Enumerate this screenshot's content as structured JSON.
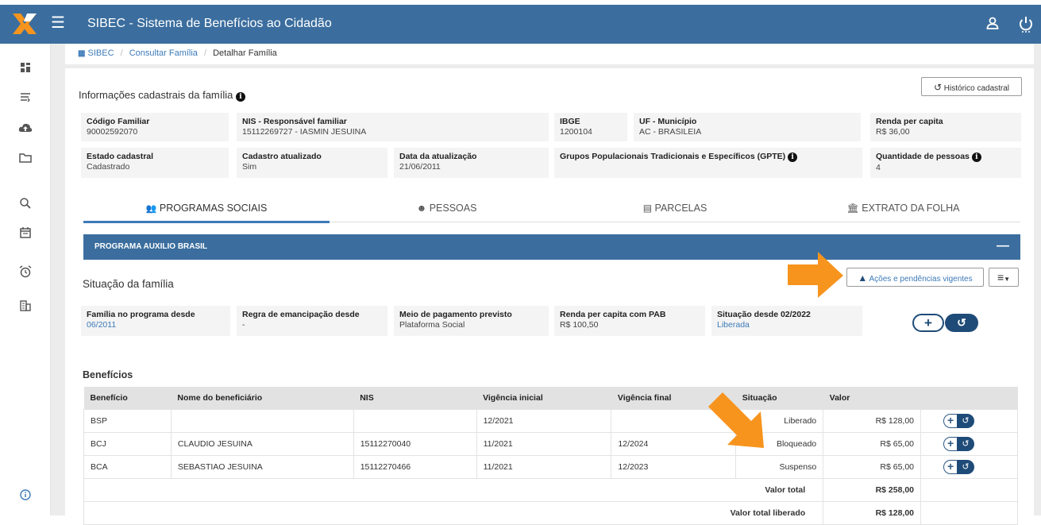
{
  "app": {
    "title": "SIBEC - Sistema de Benefícios ao Cidadão"
  },
  "topbar_icons": [
    "menu-icon",
    "user-icon",
    "power-icon"
  ],
  "sidebar_icons": [
    "dashboard-icon",
    "list-icon",
    "cloud-upload-icon",
    "folder-icon",
    "search-icon",
    "calendar-icon",
    "alarm-clock-icon",
    "building-icon",
    "info-icon"
  ],
  "breadcrumb": {
    "root": "SIBEC",
    "sep": "/",
    "level1": "Consultar Família",
    "current": "Detalhar Família"
  },
  "family_info": {
    "title": "Informações cadastrais da família",
    "history_button": "Histórico cadastral",
    "fields": {
      "codigo_familiar": {
        "label": "Código Familiar",
        "value": "90002592070"
      },
      "nis": {
        "label": "NIS - Responsável familiar",
        "value": "15112269727 - IASMIN JESUINA"
      },
      "ibge": {
        "label": "IBGE",
        "value": "1200104"
      },
      "uf_municipio": {
        "label": "UF - Município",
        "value": "AC - BRASILEIA"
      },
      "renda_per_capita": {
        "label": "Renda per capita",
        "value": "R$ 36,00"
      },
      "estado_cadastral": {
        "label": "Estado cadastral",
        "value": "Cadastrado"
      },
      "cadastro_atualizado": {
        "label": "Cadastro atualizado",
        "value": "Sim"
      },
      "data_atualizacao": {
        "label": "Data da atualização",
        "value": "21/06/2011"
      },
      "gpte": {
        "label": "Grupos Populacionais Tradicionais e Específicos (GPTE)",
        "value": ""
      },
      "quantidade_pessoas": {
        "label": "Quantidade de pessoas",
        "value": "4"
      }
    }
  },
  "tabs": [
    {
      "label": "PROGRAMAS SOCIAIS",
      "icon": "users-icon",
      "active": true
    },
    {
      "label": "PESSOAS",
      "icon": "user-circle-icon",
      "active": false
    },
    {
      "label": "PARCELAS",
      "icon": "list-alt-icon",
      "active": false
    },
    {
      "label": "EXTRATO DA FOLHA",
      "icon": "bank-icon",
      "active": false
    }
  ],
  "program": {
    "name": "PROGRAMA AUXILIO BRASIL",
    "collapse_symbol": "—"
  },
  "situacao": {
    "title": "Situação da família",
    "acoes_button": "Ações e pendências vigentes",
    "fields": {
      "familia_programa": {
        "label": "Família no programa desde",
        "value": "06/2011"
      },
      "regra_emancipacao": {
        "label": "Regra de emancipação desde",
        "value": "-"
      },
      "meio_pagamento": {
        "label": "Meio de pagamento previsto",
        "value": "Plataforma Social"
      },
      "renda_pab": {
        "label": "Renda per capita com PAB",
        "value": "R$ 100,50"
      },
      "situacao_desde": {
        "label": "Situação desde 02/2022",
        "value": "Liberada"
      }
    }
  },
  "beneficios": {
    "title": "Benefícios",
    "columns": [
      "Benefício",
      "Nome do beneficiário",
      "NIS",
      "Vigência inicial",
      "Vigência final",
      "Situação",
      "Valor"
    ],
    "rows": [
      {
        "beneficio": "BSP",
        "nome": "",
        "nis": "",
        "vig_ini": "12/2021",
        "vig_fim": "",
        "situacao": "Liberado",
        "valor": "R$ 128,00"
      },
      {
        "beneficio": "BCJ",
        "nome": "CLAUDIO JESUINA",
        "nis": "15112270040",
        "vig_ini": "11/2021",
        "vig_fim": "12/2024",
        "situacao": "Bloqueado",
        "valor": "R$ 65,00"
      },
      {
        "beneficio": "BCA",
        "nome": "SEBASTIAO JESUINA",
        "nis": "15112270466",
        "vig_ini": "11/2021",
        "vig_fim": "12/2023",
        "situacao": "Suspenso",
        "valor": "R$ 65,00"
      }
    ],
    "total_label": "Valor total",
    "total_value": "R$ 258,00",
    "total_liberado_label": "Valor total liberado",
    "total_liberado_value": "R$ 128,00"
  },
  "colors": {
    "primary": "#3b6e9e",
    "accent_orange": "#f7941d",
    "link": "#3d7ab8",
    "dark_blue": "#1f4b78"
  }
}
